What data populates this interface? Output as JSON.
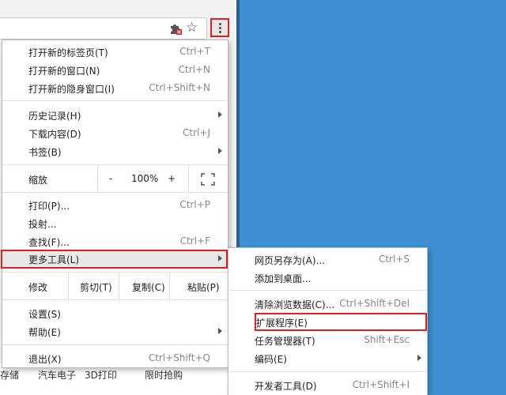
{
  "menu": {
    "group1": [
      {
        "label": "打开新的标签页(T)",
        "shortcut": "Ctrl+T"
      },
      {
        "label": "打开新的窗口(N)",
        "shortcut": "Ctrl+N"
      },
      {
        "label": "打开新的隐身窗口(I)",
        "shortcut": "Ctrl+Shift+N"
      }
    ],
    "group2": [
      {
        "label": "历史记录(H)",
        "shortcut": ""
      },
      {
        "label": "下载内容(D)",
        "shortcut": "Ctrl+J"
      },
      {
        "label": "书签(B)",
        "shortcut": ""
      }
    ],
    "zoom": {
      "label": "缩放",
      "minus": "-",
      "value": "100%",
      "plus": "+"
    },
    "group3": [
      {
        "label": "打印(P)...",
        "shortcut": "Ctrl+P"
      },
      {
        "label": "投射...",
        "shortcut": ""
      },
      {
        "label": "查找(F)...",
        "shortcut": "Ctrl+F"
      },
      {
        "label": "更多工具(L)",
        "shortcut": ""
      }
    ],
    "edit": {
      "label": "修改",
      "cut": "剪切(T)",
      "copy": "复制(C)",
      "paste": "粘贴(P)"
    },
    "group4": [
      {
        "label": "设置(S)",
        "shortcut": ""
      },
      {
        "label": "帮助(E)",
        "shortcut": ""
      }
    ],
    "exit": {
      "label": "退出(X)",
      "shortcut": "Ctrl+Shift+Q"
    }
  },
  "submenu": {
    "items": [
      {
        "label": "网页另存为(A)...",
        "shortcut": "Ctrl+S"
      },
      {
        "label": "添加到桌面...",
        "shortcut": ""
      },
      {
        "label": "清除浏览数据(C)...",
        "shortcut": "Ctrl+Shift+Del"
      },
      {
        "label": "扩展程序(E)",
        "shortcut": ""
      },
      {
        "label": "任务管理器(T)",
        "shortcut": "Shift+Esc"
      },
      {
        "label": "编码(E)",
        "shortcut": ""
      },
      {
        "label": "开发者工具(D)",
        "shortcut": "Ctrl+Shift+I"
      }
    ]
  },
  "page": {
    "bottom_links": [
      "存储",
      "汽车电子",
      "3D打印",
      "限时抢购"
    ]
  },
  "colors": {
    "desktop": "#3d8fd1",
    "highlight_box": "#e02020",
    "hover": "#e8e8e8"
  },
  "icons": {
    "extension": "puzzle-icon",
    "bookmark": "star-icon",
    "menu": "kebab-menu-icon",
    "fullscreen": "fullscreen-icon",
    "submenu": "chevron-right-icon"
  }
}
